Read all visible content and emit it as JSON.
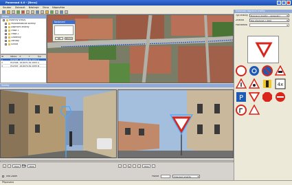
{
  "window": {
    "title": "Paneroad 4.0 - [Brno]"
  },
  "menu": [
    "Soubor",
    "Zobrazit",
    "Nástroje",
    "Okno",
    "Nápověda"
  ],
  "left_panel": {
    "header": "Vrstvy",
    "tree": [
      "Všechny vrstvy",
      "Panoramatické snímky",
      "Dopravní značky",
      "Trasa 1",
      "Trasa 2",
      "Chodníky",
      "Obruby",
      "Silnice"
    ]
  },
  "table": {
    "columns": [
      "ID",
      "Název",
      "X",
      "Y",
      "Typ"
    ],
    "rows": [
      [
        "1",
        "P12345",
        "16.6068",
        "49.1951",
        "A"
      ],
      [
        "2",
        "P12346",
        "16.6071",
        "49.1953",
        "A"
      ],
      [
        "3",
        "P12347",
        "16.6074",
        "49.1955",
        "B"
      ]
    ]
  },
  "map_dialog": {
    "title": "Nastavení",
    "ok": "OK",
    "cancel": "Storno"
  },
  "photos": {
    "header": "Snímky"
  },
  "controls": {
    "left_value": "3890",
    "right_value": "3890",
    "pos_label": "Pos",
    "pos_value": "3890"
  },
  "bottom": {
    "checkbox_label": "Info Zoom",
    "field_label": "Pozice",
    "select_value": "Dopravní značky"
  },
  "status": {
    "text": "Připraveno"
  },
  "right_panel": {
    "header": "Vlastnosti dopravní značky",
    "fields": [
      {
        "label": "Typ značky",
        "value": "Dopravní značky - upravující"
      },
      {
        "label": "Značka",
        "value": "Dej přednost v jízdě"
      },
      {
        "label": "Poznámka",
        "value": ""
      }
    ],
    "sign_selected": "P4 Dej přednost v jízdě"
  },
  "colors": {
    "title_bar": "#1d4fb0",
    "panel_header": "#8fa9d8",
    "sign_red": "#d8261c",
    "sign_blue": "#1e5ab4"
  }
}
